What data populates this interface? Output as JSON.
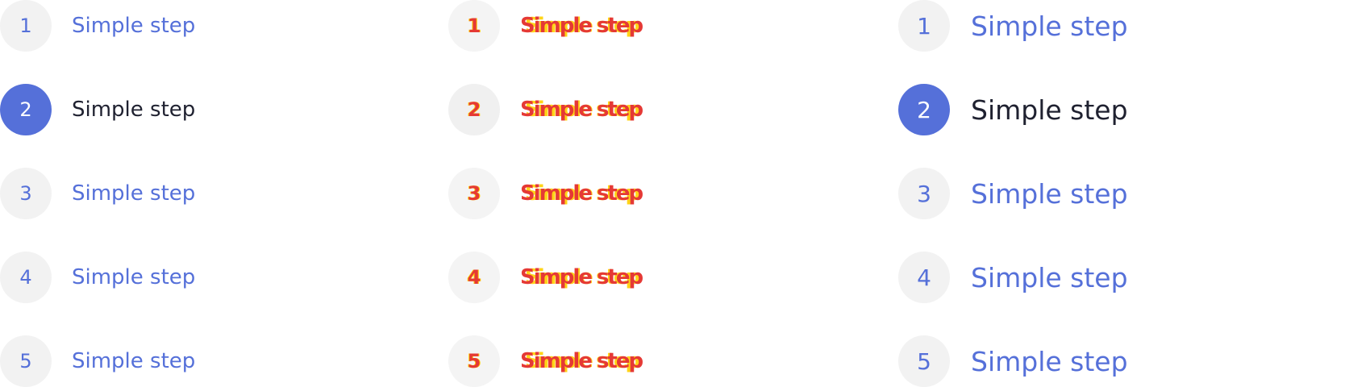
{
  "colors": {
    "accent": "#5570d9",
    "inactive_circle_bg": "#f2f2f2",
    "active_text": "#1f2130",
    "diff_red": "#e53935",
    "diff_yellow": "#ffd000"
  },
  "left_stepper": {
    "steps": [
      {
        "number": "1",
        "label": "Simple step",
        "active": false
      },
      {
        "number": "2",
        "label": "Simple step",
        "active": true
      },
      {
        "number": "3",
        "label": "Simple step",
        "active": false
      },
      {
        "number": "4",
        "label": "Simple step",
        "active": false
      },
      {
        "number": "5",
        "label": "Simple step",
        "active": false
      }
    ]
  },
  "middle_stepper": {
    "steps": [
      {
        "number": "1",
        "label": "Simple step"
      },
      {
        "number": "2",
        "label": "Simple step"
      },
      {
        "number": "3",
        "label": "Simple step"
      },
      {
        "number": "4",
        "label": "Simple step"
      },
      {
        "number": "5",
        "label": "Simple step"
      }
    ]
  },
  "right_stepper": {
    "steps": [
      {
        "number": "1",
        "label": "Simple step",
        "active": false
      },
      {
        "number": "2",
        "label": "Simple step",
        "active": true
      },
      {
        "number": "3",
        "label": "Simple step",
        "active": false
      },
      {
        "number": "4",
        "label": "Simple step",
        "active": false
      },
      {
        "number": "5",
        "label": "Simple step",
        "active": false
      }
    ]
  }
}
